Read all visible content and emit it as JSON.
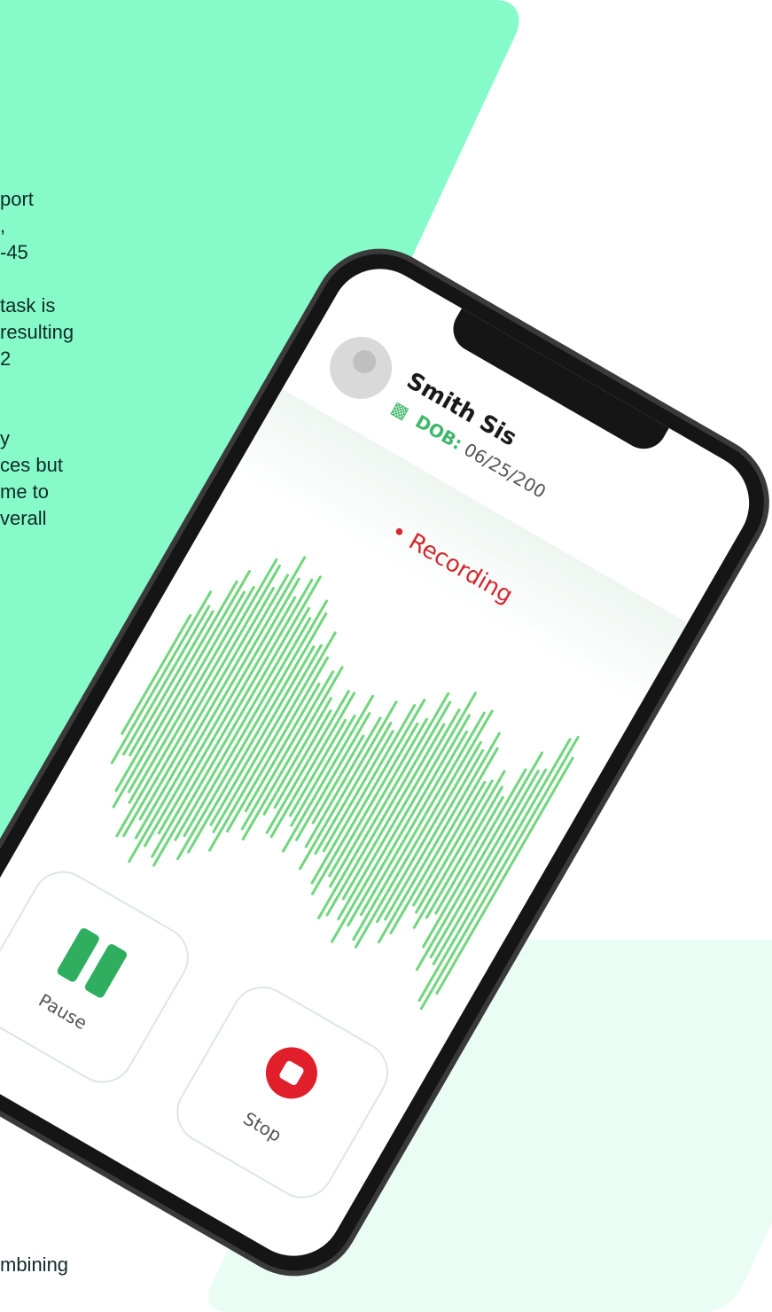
{
  "side_text_lines": [
    "port",
    ",",
    "-45",
    "",
    "task is",
    "resulting",
    "2",
    "",
    "",
    "y",
    "ces but",
    "me to",
    "verall"
  ],
  "bottom_text": "mbining",
  "patient": {
    "name": "Smith Sis",
    "dob_label": "DOB:",
    "dob_value": "06/25/200"
  },
  "status": {
    "recording_label": "• Recording"
  },
  "controls": {
    "pause_label": "Pause",
    "stop_label": "Stop"
  },
  "colors": {
    "panel": "#86fbc9",
    "waveform": "#6fd67c",
    "recording": "#d2282e",
    "pause_icon": "#2fae5f",
    "stop_icon": "#e01f2a"
  },
  "icons": [
    "avatar-icon",
    "cake-icon",
    "pause-icon",
    "stop-icon"
  ]
}
